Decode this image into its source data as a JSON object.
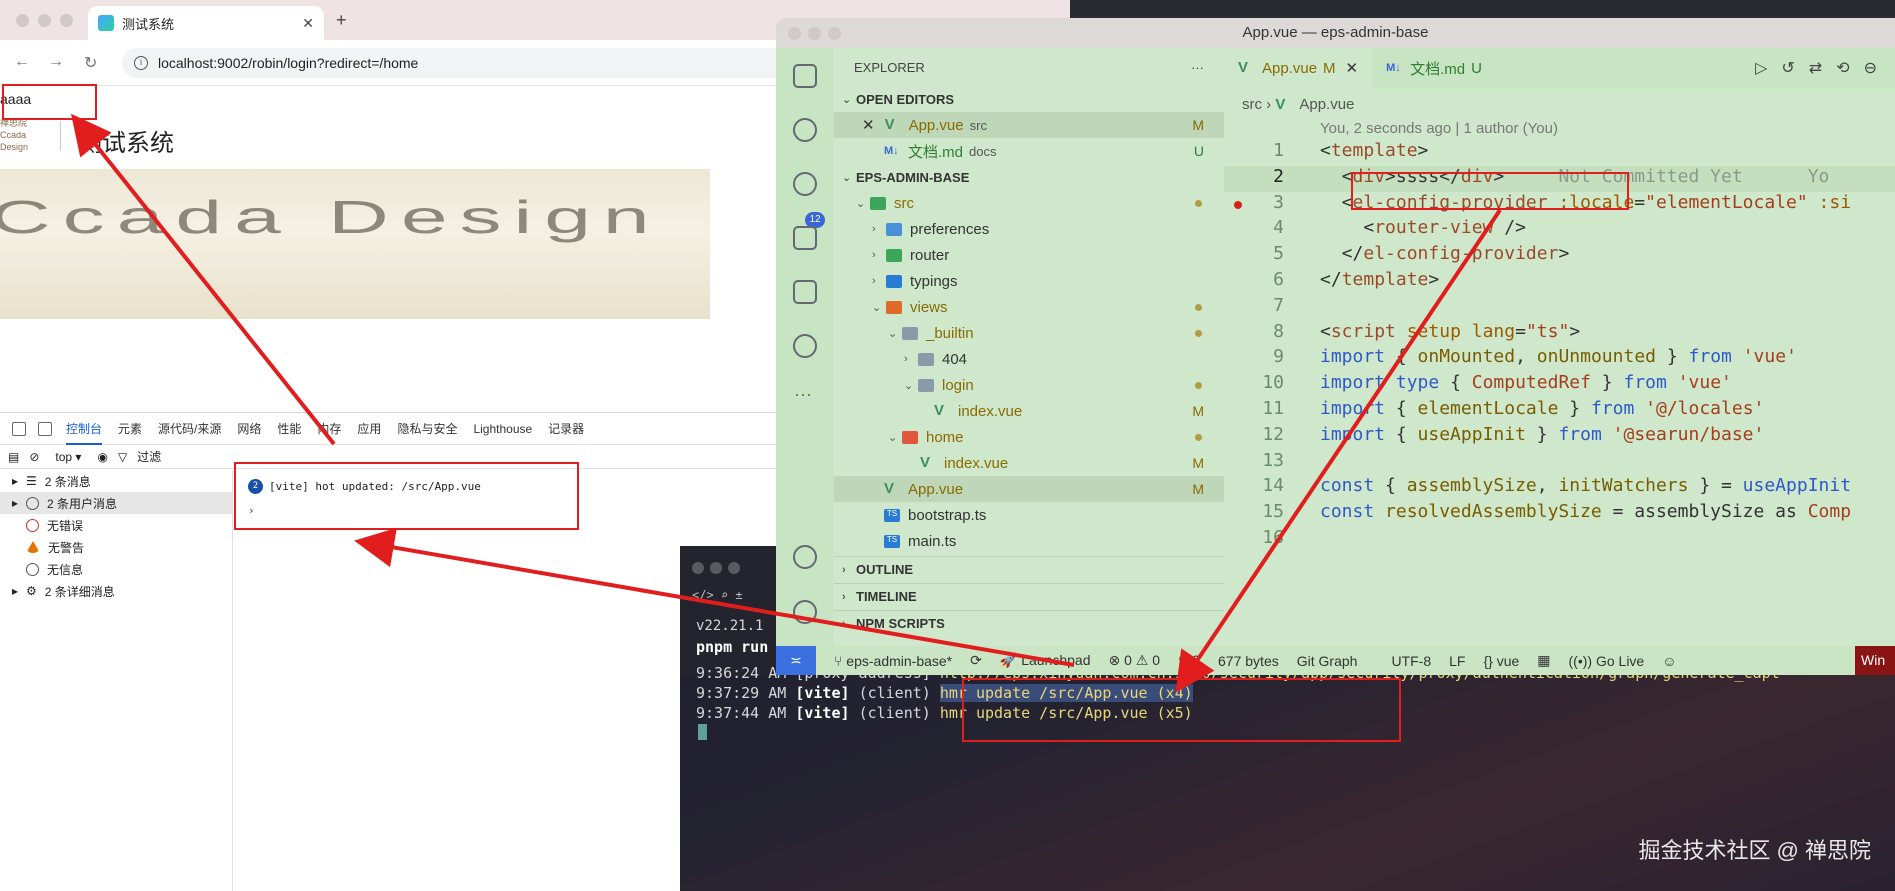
{
  "browser": {
    "tab_title": "测试系统",
    "url": "localhost:9002/robin/login?redirect=/home",
    "page": {
      "test_text": "aaaa",
      "logo_text": "禅思院 Ccada Design",
      "system_title": "测试系统"
    },
    "devtools": {
      "tabs": [
        "控制台",
        "元素",
        "源代码/来源",
        "网络",
        "性能",
        "内存",
        "应用",
        "隐私与安全",
        "Lighthouse",
        "记录器"
      ],
      "context": "top",
      "filter_placeholder": "过滤",
      "sidebar": [
        {
          "label": "2 条消息",
          "icon": "list-icon"
        },
        {
          "label": "2 条用户消息",
          "icon": "user-icon"
        },
        {
          "label": "无错误",
          "icon": "error-icon"
        },
        {
          "label": "无警告",
          "icon": "warning-icon"
        },
        {
          "label": "无信息",
          "icon": "info-icon"
        },
        {
          "label": "2 条详细消息",
          "icon": "bug-icon"
        }
      ],
      "console": {
        "count": "2",
        "message": "[vite] hot updated: /src/App.vue",
        "prompt": "›"
      }
    }
  },
  "vscode": {
    "window_title": "App.vue — eps-admin-base",
    "explorer_title": "EXPLORER",
    "explorer_more": "···",
    "source_control_badge": "12",
    "sections": {
      "open_editors": "OPEN EDITORS",
      "project": "EPS-ADMIN-BASE",
      "outline": "OUTLINE",
      "timeline": "TIMELINE",
      "npm_scripts": "NPM SCRIPTS"
    },
    "open_editors": [
      {
        "name": "App.vue",
        "meta": "src",
        "status": "M"
      },
      {
        "name": "文档.md",
        "meta": "docs",
        "status": "U"
      }
    ],
    "tree": [
      {
        "name": "src",
        "status": "dot"
      },
      {
        "name": "preferences",
        "status": ""
      },
      {
        "name": "router",
        "status": ""
      },
      {
        "name": "typings",
        "status": ""
      },
      {
        "name": "views",
        "status": "dot"
      },
      {
        "name": "_builtin",
        "status": "dot"
      },
      {
        "name": "404",
        "status": ""
      },
      {
        "name": "login",
        "status": "dot"
      },
      {
        "name": "index.vue",
        "status": "M"
      },
      {
        "name": "home",
        "status": "dot"
      },
      {
        "name": "index.vue",
        "status": "M"
      },
      {
        "name": "App.vue",
        "status": "M"
      },
      {
        "name": "bootstrap.ts",
        "status": ""
      },
      {
        "name": "main.ts",
        "status": ""
      }
    ],
    "editor_tabs": [
      {
        "name": "App.vue",
        "status": "M"
      },
      {
        "name": "文档.md",
        "status": "U"
      }
    ],
    "breadcrumb": [
      "src",
      "App.vue"
    ],
    "blame": "You, 2 seconds ago | 1 author (You)",
    "inline_blame": "Not Committed Yet",
    "inline_blame_tail": "Yo",
    "line_numbers": [
      "1",
      "2",
      "3",
      "4",
      "5",
      "6",
      "7",
      "8",
      "9",
      "10",
      "11",
      "12",
      "13",
      "14",
      "15",
      "16"
    ],
    "statusbar": {
      "branch": "eps-admin-base*",
      "launchpad": "Launchpad",
      "errors": "0",
      "warnings": "0",
      "ports": "0",
      "size": "677 bytes",
      "git_graph": "Git Graph",
      "encoding": "UTF-8",
      "eol": "LF",
      "language": "vue",
      "go_live": "Go Live",
      "win": "Win"
    }
  },
  "terminal": {
    "node_version": "v22.21.1",
    "command": "pnpm run",
    "lines": [
      {
        "time": "9:36:24 AM",
        "tag": "[proxy address]",
        "text": "http://eps.xinyuan.com.cn:9000/security/app/security/proxy/authentication/graph/generate_capt"
      },
      {
        "time": "9:37:29 AM",
        "tag": "[vite]",
        "client": "(client)",
        "text": "hmr update /src/App.vue (x4)"
      },
      {
        "time": "9:37:44 AM",
        "tag": "[vite]",
        "client": "(client)",
        "text": "hmr update /src/App.vue (x5)"
      }
    ],
    "watermark": "掘金技术社区 @ 禅思院"
  },
  "colors": {
    "annotation_red": "#e11d1d",
    "vscode_theme_green": "#cfe8cb",
    "remote_blue": "#3b6fe0"
  }
}
